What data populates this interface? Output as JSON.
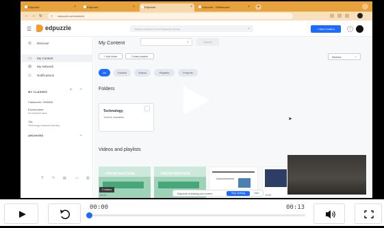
{
  "browser": {
    "tabs": [
      {
        "label": "Edpuzzle"
      },
      {
        "label": "Edpuzzle"
      },
      {
        "label": "Edpuzzle"
      },
      {
        "label": "Edpuzzle - Whiteboard"
      }
    ],
    "new_tab_label": "+",
    "url": "edpuzzle.com/content",
    "tab_color": "#e8a23c"
  },
  "app": {
    "brand": "edpuzzle",
    "search_placeholder": "Search content in the Edpuzzle library",
    "add_content_label": "+ Add Content",
    "help_label": "?",
    "accent": "#1e6bff"
  },
  "sidebar": {
    "items": [
      {
        "label": "Discover",
        "icon": "compass-icon"
      },
      {
        "label": "My Content",
        "icon": "folder-icon"
      },
      {
        "label": "My Network",
        "icon": "network-icon"
      },
      {
        "label": "Notifications",
        "icon": "bell-icon"
      }
    ],
    "classes_heading": "MY CLASSES",
    "classroom_label": "Classroom: GH8516",
    "classes": [
      {
        "name": "Environment",
        "desc": "Environment class"
      },
      {
        "name": "TEL",
        "desc": "Technology enhanced learning"
      }
    ],
    "archived_label": "ARCHIVED"
  },
  "main": {
    "title": "My Content",
    "search_button": "Search",
    "add_folder": "+ Add folder",
    "create_playlist": "Create playlist",
    "sort_value": "Newest",
    "filters": [
      "All",
      "Folders",
      "Videos",
      "Playlists",
      "Projects"
    ],
    "folders_heading": "Folders",
    "folder": {
      "name": "Technology",
      "desc": "Tools for education"
    },
    "videos_heading": "Videos and playlists",
    "thumb_word": "FRUSTRATION",
    "videos_badge": "2 videos",
    "durations": [
      "16:14",
      "13:20"
    ],
    "sharing_message": "Edpuzzle is sharing your screen.",
    "stop_sharing": "Stop sharing",
    "hide_label": "Hide"
  },
  "player": {
    "current_time": "00:00",
    "duration": "00:13",
    "progress": 0.0,
    "play_icon": "play-icon",
    "replay_icon": "replay-icon",
    "volume_icon": "volume-icon",
    "fullscreen_icon": "fullscreen-icon"
  }
}
